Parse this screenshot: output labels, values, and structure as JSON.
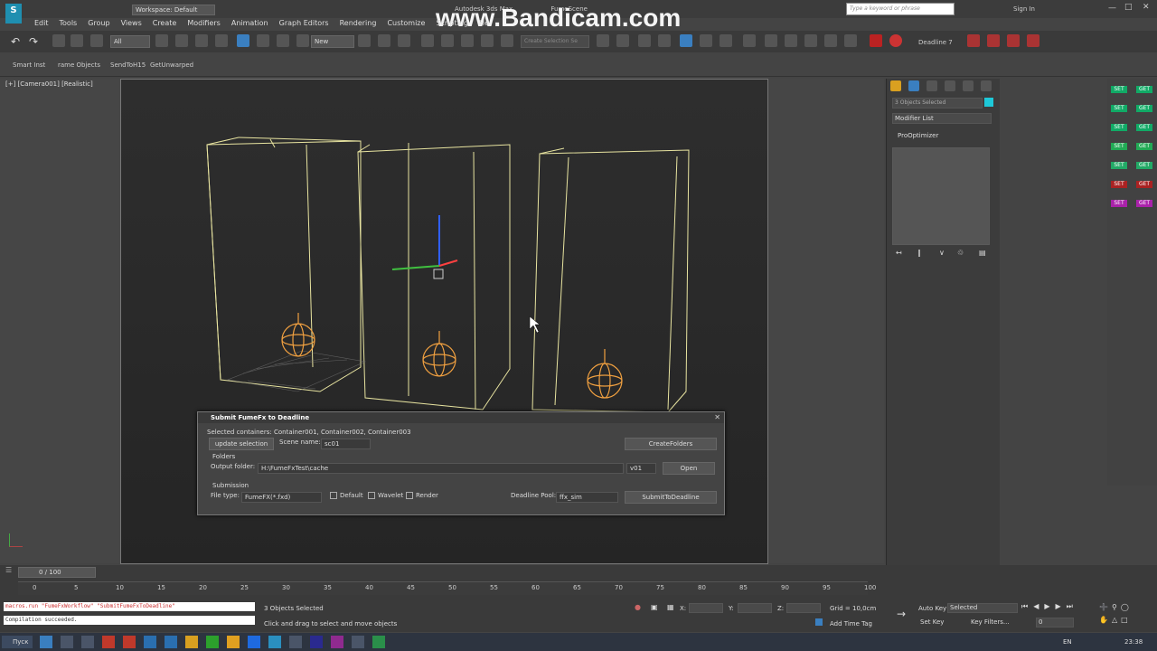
{
  "window": {
    "app_title": "Autodesk 3ds Max",
    "file_title": "FumeScene",
    "watermark": "www.Bandicam.com",
    "workspace": "Workspace: Default",
    "search_placeholder": "Type a keyword or phrase",
    "sign_in": "Sign In"
  },
  "menubar": [
    "Edit",
    "Tools",
    "Group",
    "Views",
    "Create",
    "Modifiers",
    "Animation",
    "Graph Editors",
    "Rendering",
    "Customize",
    "Scripting",
    "He"
  ],
  "toolbar": {
    "selection_filter": "All",
    "named_set": "New",
    "create_selection_set": "Create Selection Se",
    "deadline": "Deadline 7"
  },
  "ribbon": [
    "Smart Inst",
    "rame Objects",
    "SendToH15",
    "GetUnwarped"
  ],
  "viewport": {
    "label": "[+] [Camera001] [Realistic]"
  },
  "command_panel": {
    "objects_selected": "3 Objects Selected",
    "modifier_list": "Modifier List",
    "pro_optimizer": "ProOptimizer"
  },
  "dialog": {
    "title": "Submit FumeFx to Deadline",
    "selected_containers": "Selected containers: Container001, Container002, Container003",
    "update_selection": "update selection",
    "scene_name_label": "Scene name:",
    "scene_name_value": "sc01",
    "create_folders": "CreateFolders",
    "folders_group": "Folders",
    "output_folder_label": "Output folder:",
    "output_folder_value": "H:\\FumeFxTest\\cache",
    "version": "v01",
    "open": "Open",
    "submission_group": "Submission",
    "file_type_label": "File type:",
    "file_type_value": "FumeFX(*.fxd)",
    "check_default": "Default",
    "check_wavelet": "Wavelet",
    "check_render": "Render",
    "deadline_pool_label": "Deadline Pool:",
    "deadline_pool_value": "ffx_sim",
    "submit": "SubmitToDeadline"
  },
  "timeline": {
    "frame_counter": "0 / 100",
    "ticks": [
      "0",
      "5",
      "10",
      "15",
      "20",
      "25",
      "30",
      "35",
      "40",
      "45",
      "50",
      "55",
      "60",
      "65",
      "70",
      "75",
      "80",
      "85",
      "90",
      "95",
      "100"
    ]
  },
  "status": {
    "macro_line": "macros.run \"FumeFxWorkflow\" \"SubmitFumeFxToDeadline\"",
    "compile_line": "Compilation succeeded.",
    "selected": "3 Objects Selected",
    "hint": "Click and drag to select and move objects",
    "x_label": "X:",
    "y_label": "Y:",
    "z_label": "Z:",
    "grid": "Grid = 10,0cm",
    "add_time_tag": "Add Time Tag",
    "auto_key": "Auto Key",
    "selected_dropdown": "Selected",
    "set_key": "Set Key",
    "key_filters": "Key Filters...",
    "frame_value": "0"
  },
  "taskbar": {
    "start": "Пуск",
    "lang": "EN",
    "clock": "23:38"
  },
  "right_buttons": [
    "SET",
    "GET",
    "SET",
    "GET",
    "SET",
    "GET",
    "SET",
    "GET",
    "SET",
    "GET",
    "SET",
    "GET",
    "SET",
    "GET"
  ]
}
